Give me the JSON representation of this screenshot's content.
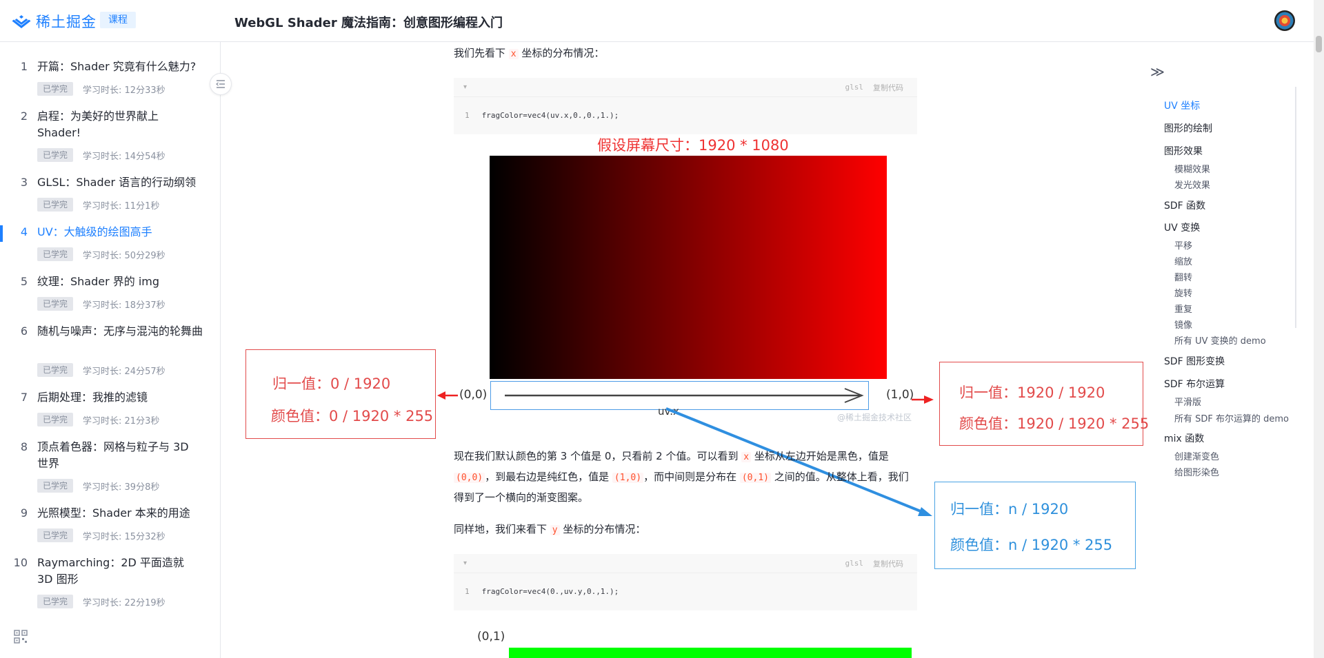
{
  "header": {
    "logo_text": "稀土掘金",
    "course_badge": "课程",
    "book_title": "WebGL Shader 魔法指南：创意图形编程入门"
  },
  "sidebar": {
    "chapters": [
      {
        "num": "1",
        "title": "开篇：Shader 究竟有什么魅力?",
        "badge": "已学完",
        "duration": "学习时长: 12分33秒"
      },
      {
        "num": "2",
        "title": "启程：为美好的世界献上 Shader!",
        "badge": "已学完",
        "duration": "学习时长: 14分54秒"
      },
      {
        "num": "3",
        "title": "GLSL：Shader 语言的行动纲领",
        "badge": "已学完",
        "duration": "学习时长: 11分1秒"
      },
      {
        "num": "4",
        "title": "UV：大触级的绘图高手",
        "badge": "已学完",
        "duration": "学习时长: 50分29秒"
      },
      {
        "num": "5",
        "title": "纹理：Shader 界的 img",
        "badge": "已学完",
        "duration": "学习时长: 18分37秒"
      },
      {
        "num": "6",
        "title": "随机与噪声：无序与混沌的轮舞曲",
        "badge": "已学完",
        "duration": "学习时长: 24分57秒"
      },
      {
        "num": "7",
        "title": "后期处理：我推的滤镜",
        "badge": "已学完",
        "duration": "学习时长: 21分3秒"
      },
      {
        "num": "8",
        "title": "顶点着色器：网格与粒子与 3D 世界",
        "badge": "已学完",
        "duration": "学习时长: 39分8秒"
      },
      {
        "num": "9",
        "title": "光照模型：Shader 本来的用途",
        "badge": "已学完",
        "duration": "学习时长: 15分32秒"
      },
      {
        "num": "10",
        "title": "Raymarching：2D 平面造就 3D 图形",
        "badge": "已学完",
        "duration": "学习时长: 22分19秒"
      }
    ]
  },
  "article": {
    "p1_pre": "我们先看下 ",
    "p1_code": "x",
    "p1_post": " 坐标的分布情况：",
    "code1": {
      "toggle": "▾",
      "lang": "glsl",
      "copy": "复制代码",
      "line_no": "1",
      "code": "fragColor=vec4(uv.x,0.,0.,1.);"
    },
    "fig1_title": "假设屏幕尺寸：1920 * 1080",
    "coord_left": "(0,0)",
    "coord_right": "(1,0)",
    "uv_label": "uv.x",
    "watermark": "@稀土掘金技术社区",
    "note_left": {
      "line1": "归一值：0 / 1920",
      "line2": "颜色值：0 / 1920 * 255"
    },
    "note_right": {
      "line1": "归一值：1920 / 1920",
      "line2": "颜色值：1920 / 1920 * 255"
    },
    "note_blue": {
      "line1": "归一值：n / 1920",
      "line2": "颜色值：n / 1920 * 255"
    },
    "p2": {
      "a": "现在我们默认颜色的第 3 个值是 0，只看前 2 个值。可以看到 ",
      "code_x": "x",
      "b": " 坐标从左边开始是黑色，值是 ",
      "code_00": "(0,0)",
      "c": "，到最右边是纯红色，值是 ",
      "code_10": "(1,0)",
      "d": "，而中间则是分布在 ",
      "code_01": "(0,1)",
      "e": " 之间的值。从整体上看，我们得到了一个横向的渐变图案。"
    },
    "p3_pre": "同样地，我们来看下 ",
    "p3_code": "y",
    "p3_post": " 坐标的分布情况：",
    "code2": {
      "toggle": "▾",
      "lang": "glsl",
      "copy": "复制代码",
      "line_no": "1",
      "code": "fragColor=vec4(0.,uv.y,0.,1.);"
    },
    "coord_01": "(0,1)"
  },
  "toc": {
    "toggle": "≫",
    "items": [
      {
        "label": "UV 坐标",
        "level": 1,
        "active": true
      },
      {
        "label": "图形的绘制",
        "level": 1
      },
      {
        "label": "图形效果",
        "level": 1
      },
      {
        "label": "模糊效果",
        "level": 2
      },
      {
        "label": "发光效果",
        "level": 2
      },
      {
        "label": "SDF 函数",
        "level": 1
      },
      {
        "label": "UV 变换",
        "level": 1
      },
      {
        "label": "平移",
        "level": 2
      },
      {
        "label": "缩放",
        "level": 2
      },
      {
        "label": "翻转",
        "level": 2
      },
      {
        "label": "旋转",
        "level": 2
      },
      {
        "label": "重复",
        "level": 2
      },
      {
        "label": "镜像",
        "level": 2
      },
      {
        "label": "所有 UV 变换的 demo",
        "level": 2
      },
      {
        "label": "SDF 图形变换",
        "level": 1
      },
      {
        "label": "SDF 布尔运算",
        "level": 1
      },
      {
        "label": "平滑版",
        "level": 2
      },
      {
        "label": "所有 SDF 布尔运算的 demo",
        "level": 2
      },
      {
        "label": "mix 函数",
        "level": 1
      },
      {
        "label": "创建渐变色",
        "level": 2
      },
      {
        "label": "给图形染色",
        "level": 2
      }
    ]
  },
  "colors": {
    "accent": "#1e80ff",
    "note_red": "#e24a4a",
    "note_blue": "#2e90dc"
  }
}
